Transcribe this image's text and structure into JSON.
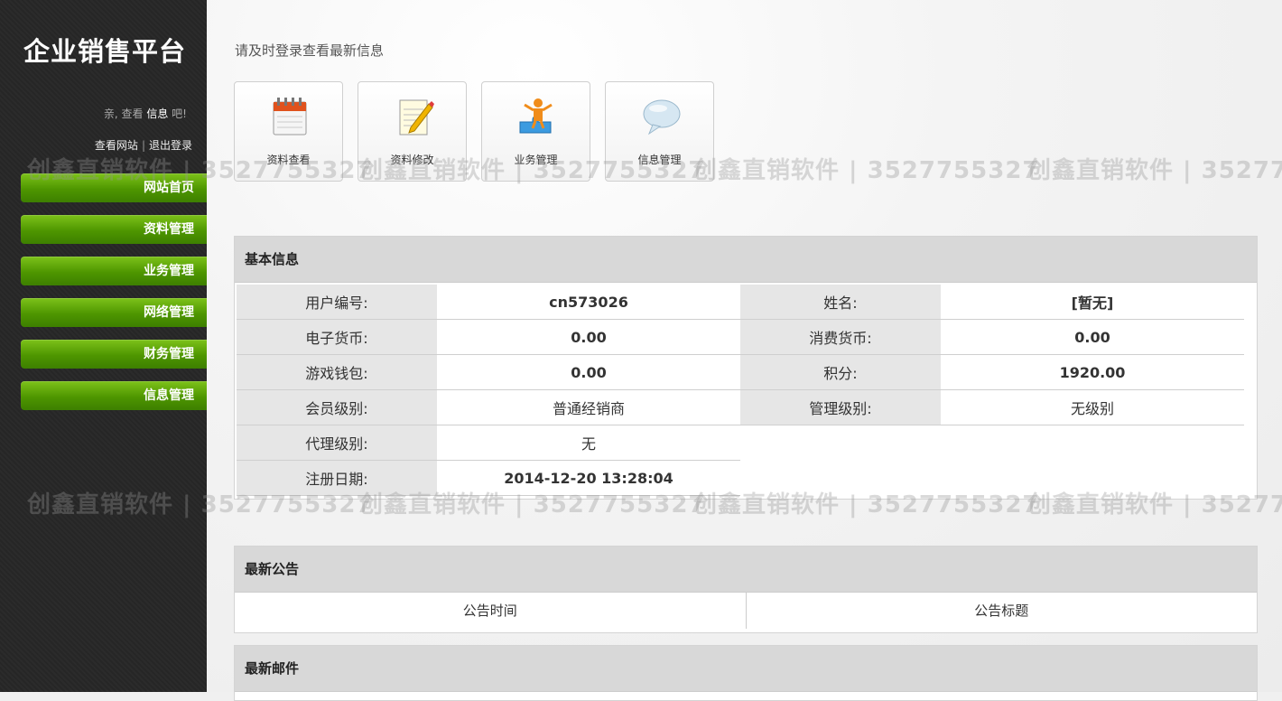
{
  "sidebar": {
    "logo": "企业销售平台",
    "greeting_prefix": "亲, 查看 ",
    "greeting_bold": "信息",
    "greeting_suffix": " 吧!",
    "link_site": "查看网站",
    "link_sep": "|",
    "link_logout": "退出登录",
    "nav": [
      "网站首页",
      "资料管理",
      "业务管理",
      "网络管理",
      "财务管理",
      "信息管理"
    ]
  },
  "main": {
    "notice": "请及时登录查看最新信息",
    "quick_links": [
      {
        "label": "资料查看",
        "icon": "calendar-icon"
      },
      {
        "label": "资料修改",
        "icon": "edit-notepad-icon"
      },
      {
        "label": "业务管理",
        "icon": "person-puzzle-icon"
      },
      {
        "label": "信息管理",
        "icon": "speech-bubble-icon"
      }
    ],
    "basic": {
      "title": "基本信息",
      "rows": [
        [
          {
            "k": "用户编号:",
            "v": "cn573026"
          },
          {
            "k": "姓名:",
            "v": "[暂无]"
          }
        ],
        [
          {
            "k": "电子货币:",
            "v": "0.00"
          },
          {
            "k": "消费货币:",
            "v": "0.00"
          }
        ],
        [
          {
            "k": "游戏钱包:",
            "v": "0.00"
          },
          {
            "k": "积分:",
            "v": "1920.00"
          }
        ],
        [
          {
            "k": "会员级别:",
            "v": "普通经销商"
          },
          {
            "k": "管理级别:",
            "v": "无级别"
          }
        ],
        [
          {
            "k": "代理级别:",
            "v": "无"
          }
        ],
        [
          {
            "k": "注册日期:",
            "v": "2014-12-20 13:28:04"
          }
        ]
      ]
    },
    "announce": {
      "title": "最新公告",
      "col_time": "公告时间",
      "col_title": "公告标题"
    },
    "mail": {
      "title": "最新邮件"
    }
  },
  "watermark": "创鑫直销软件 | 3527755327"
}
